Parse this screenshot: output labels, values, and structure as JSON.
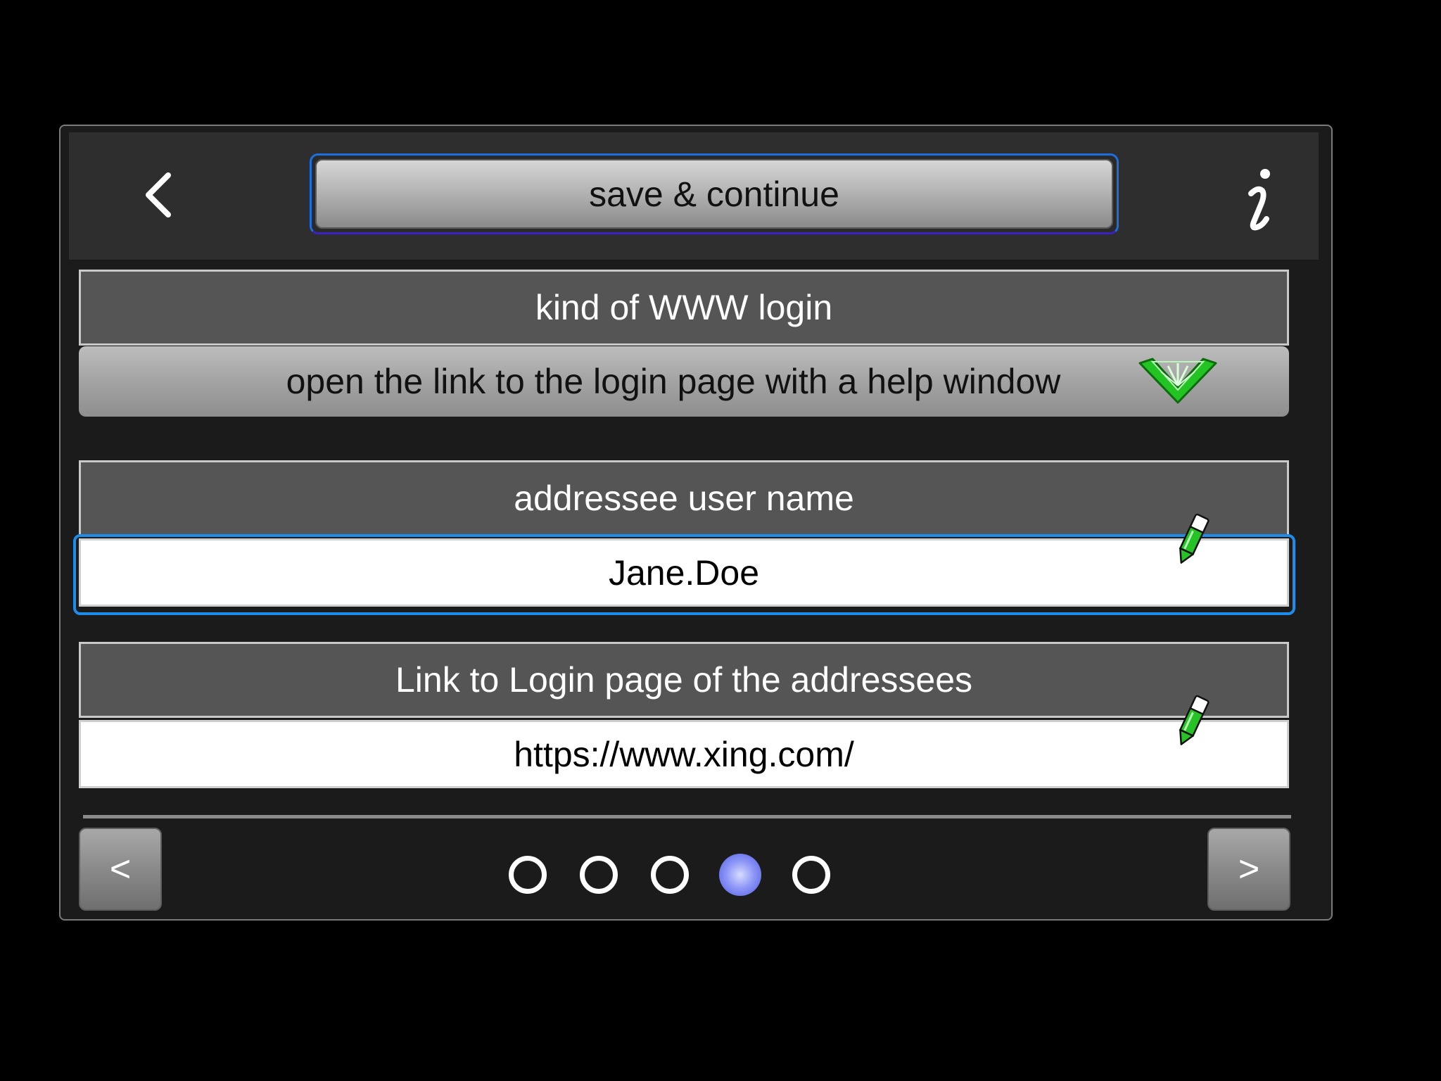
{
  "header": {
    "back_icon": "chevron-left-icon",
    "save_label": "save & continue",
    "info_icon": "info-icon"
  },
  "login_kind": {
    "label": "kind of WWW login",
    "selected": "open the link to the login page with a help window",
    "dropdown_icon": "chevron-down-icon",
    "accent_color": "#2bd42b"
  },
  "user_name": {
    "label": "addressee user name",
    "value": "Jane.Doe",
    "edit_icon": "pen-icon"
  },
  "login_link": {
    "label": "Link to Login page of the addressees",
    "value": "https://www.xing.com/",
    "edit_icon": "pen-icon"
  },
  "pager": {
    "prev_label": "<",
    "next_label": ">",
    "pages": 5,
    "current_page": 4,
    "active_color": "#6f7af0"
  }
}
